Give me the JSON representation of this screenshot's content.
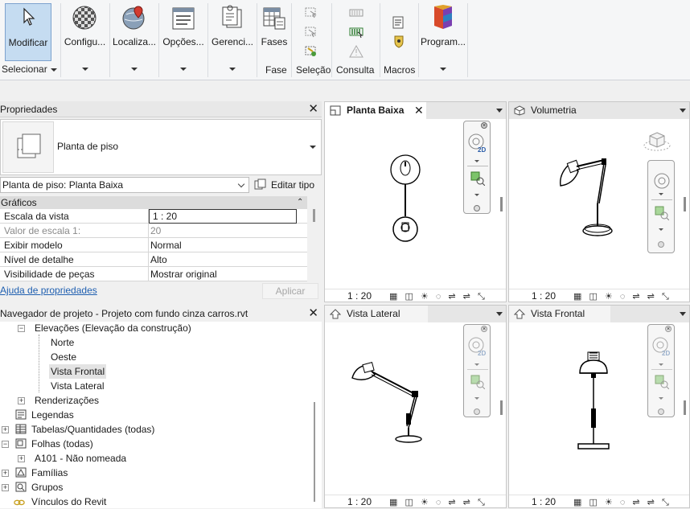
{
  "ribbon": {
    "modify": "Modificar",
    "configure": "Configu...",
    "localize": "Localiza...",
    "options": "Opções...",
    "manage": "Gerenci...",
    "phases": "Fases",
    "program": "Program...",
    "groups": {
      "select": "Selecionar",
      "phase": "Fase",
      "selection": "Seleção",
      "query": "Consulta",
      "macros": "Macros"
    }
  },
  "properties": {
    "title": "Propriedades",
    "type_name": "Planta de piso",
    "instance_selector": "Planta de piso: Planta Baixa",
    "edit_type": "Editar tipo",
    "section": "Gráficos",
    "rows": [
      {
        "key": "Escala da vista",
        "value": "1 : 20"
      },
      {
        "key": "Valor de escala    1:",
        "value": "20"
      },
      {
        "key": "Exibir modelo",
        "value": "Normal"
      },
      {
        "key": "Nível de detalhe",
        "value": "Alto"
      },
      {
        "key": "Visibilidade de peças",
        "value": "Mostrar original"
      }
    ],
    "help_link": "Ajuda de propriedades",
    "apply": "Aplicar"
  },
  "browser": {
    "title": "Navegador de projeto - Projeto com fundo cinza carros.rvt",
    "items": [
      "Elevações (Elevação da construção)",
      "Norte",
      "Oeste",
      "Vista Frontal",
      "Vista Lateral",
      "Renderizações",
      "Legendas",
      "Tabelas/Quantidades (todas)",
      "Folhas (todas)",
      "A101 - Não nomeada",
      "Famílias",
      "Grupos",
      "Vínculos do Revit"
    ]
  },
  "views": {
    "plan": {
      "title": "Planta Baixa",
      "scale": "1 : 20"
    },
    "iso": {
      "title": "Volumetria",
      "scale": "1 : 20"
    },
    "side": {
      "title": "Vista Lateral",
      "scale": "1 : 20"
    },
    "front": {
      "title": "Vista Frontal",
      "scale": "1 : 20"
    },
    "nav_2d": "2D"
  }
}
